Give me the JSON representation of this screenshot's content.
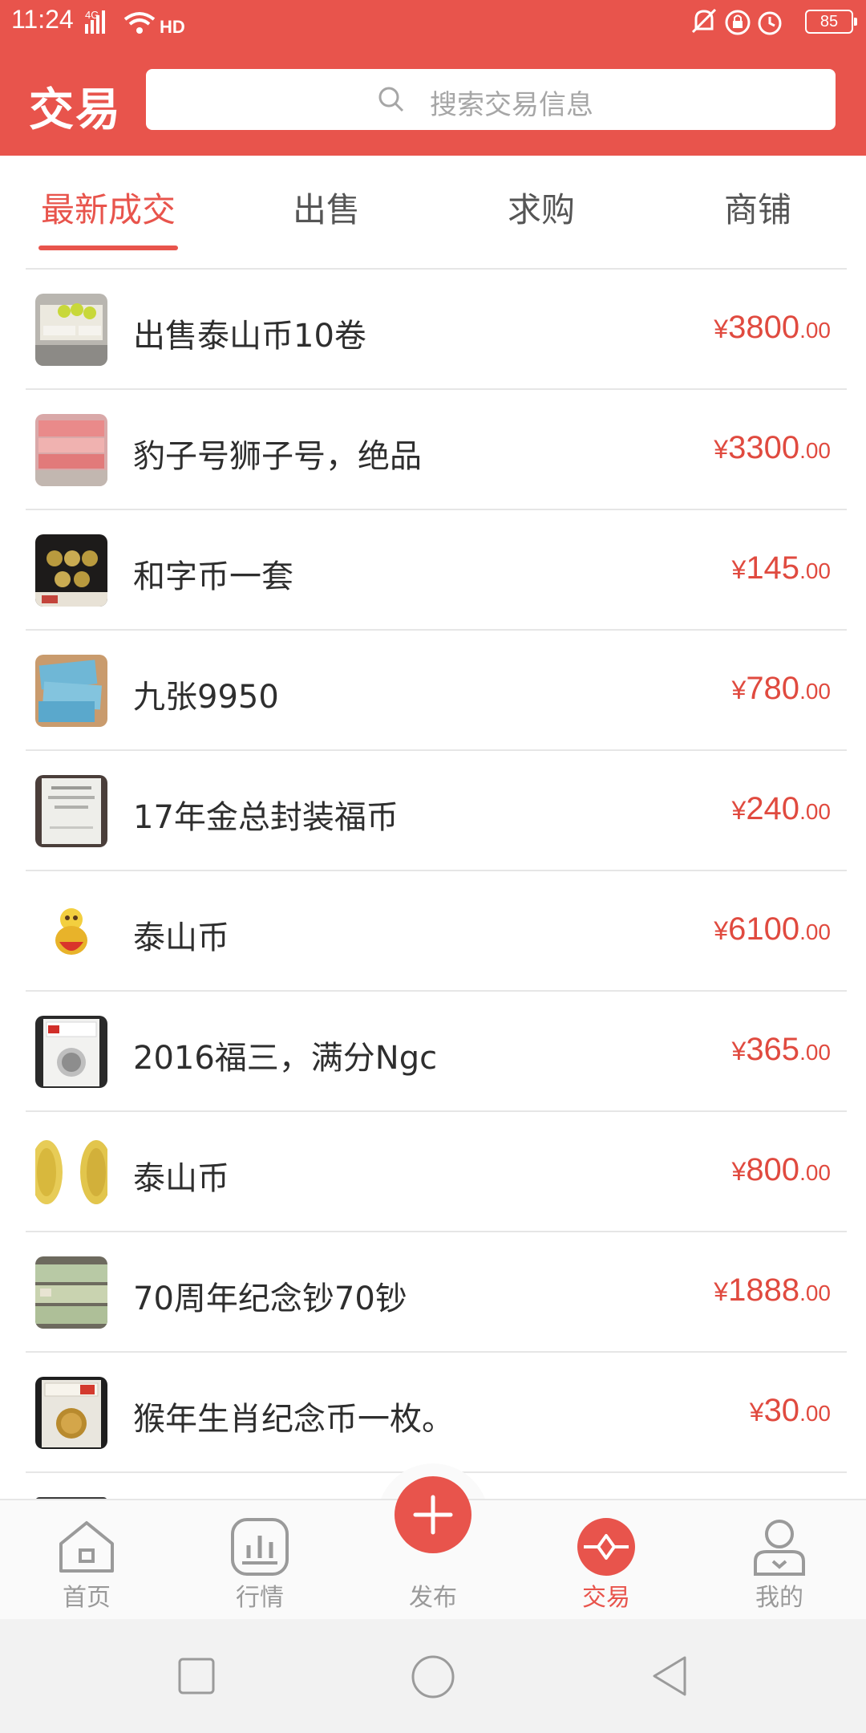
{
  "status_bar": {
    "time": "11:24",
    "network": "4G",
    "hd": "HD",
    "battery": "85"
  },
  "header": {
    "title": "交易",
    "search_placeholder": "搜索交易信息"
  },
  "tabs": [
    {
      "label": "最新成交",
      "active": true
    },
    {
      "label": "出售",
      "active": false
    },
    {
      "label": "求购",
      "active": false
    },
    {
      "label": "商铺",
      "active": false
    }
  ],
  "listings": [
    {
      "title": "出售泰山币10卷",
      "currency": "¥",
      "price_int": "3800",
      "price_dec": ".00"
    },
    {
      "title": "豹子号狮子号，绝品",
      "currency": "¥",
      "price_int": "3300",
      "price_dec": ".00"
    },
    {
      "title": "和字币一套",
      "currency": "¥",
      "price_int": "145",
      "price_dec": ".00"
    },
    {
      "title": "九张9950",
      "currency": "¥",
      "price_int": "780",
      "price_dec": ".00"
    },
    {
      "title": "17年金总封装福币",
      "currency": "¥",
      "price_int": "240",
      "price_dec": ".00"
    },
    {
      "title": "泰山币",
      "currency": "¥",
      "price_int": "6100",
      "price_dec": ".00"
    },
    {
      "title": "2016福三，满分Ngc",
      "currency": "¥",
      "price_int": "365",
      "price_dec": ".00"
    },
    {
      "title": "泰山币",
      "currency": "¥",
      "price_int": "800",
      "price_dec": ".00"
    },
    {
      "title": "70周年纪念钞70钞",
      "currency": "¥",
      "price_int": "1888",
      "price_dec": ".00"
    },
    {
      "title": "猴年生肖纪念币一枚。",
      "currency": "¥",
      "price_int": "30",
      "price_dec": ".00"
    }
  ],
  "bottom_nav": [
    {
      "label": "首页",
      "icon": "home-icon",
      "active": false
    },
    {
      "label": "行情",
      "icon": "chart-icon",
      "active": false
    },
    {
      "label": "发布",
      "icon": "plus-icon",
      "active": false
    },
    {
      "label": "交易",
      "icon": "trade-icon",
      "active": true
    },
    {
      "label": "我的",
      "icon": "profile-icon",
      "active": false
    }
  ],
  "colors": {
    "brand": "#e8544c",
    "price": "#e04a3f"
  }
}
